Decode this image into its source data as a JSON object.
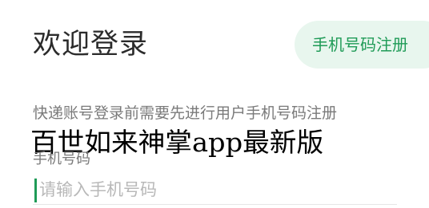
{
  "page": {
    "title": "欢迎登录",
    "register_button": "手机号码注册",
    "notice": "快递账号登录前需要先进行用户手机号码注册",
    "overlay_text": "百世如来神掌app最新版"
  },
  "phone_field": {
    "label": "手机号码",
    "placeholder": "请输入手机号码",
    "value": ""
  },
  "colors": {
    "accent": "#1f9b57",
    "button_bg": "#e8f6ee",
    "title_text": "#2b2b2b",
    "secondary_text": "#7a7a7a",
    "placeholder_text": "#b8b8b8"
  }
}
